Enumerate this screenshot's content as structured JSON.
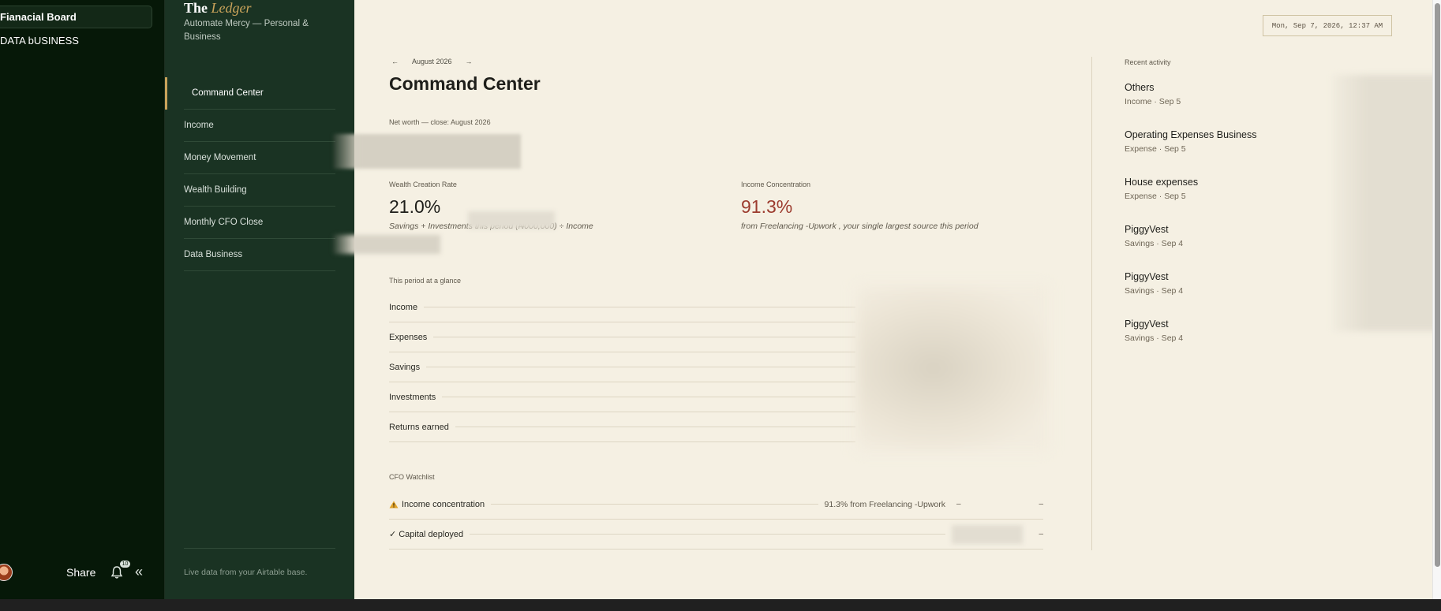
{
  "app_sidebar": {
    "items": [
      {
        "label": "Fianacial Board",
        "active": true
      },
      {
        "label": "DATA bUSINESS",
        "active": false
      }
    ],
    "footer": {
      "share_label": "Share",
      "notification_count": "10"
    }
  },
  "ledger": {
    "brand_prefix": "The",
    "brand_name": "Ledger",
    "subtitle": "Automate Mercy — Personal & Business",
    "nav": [
      {
        "label": "Command Center",
        "active": true
      },
      {
        "label": "Income",
        "active": false
      },
      {
        "label": "Money Movement",
        "active": false
      },
      {
        "label": "Wealth Building",
        "active": false
      },
      {
        "label": "Monthly CFO Close",
        "active": false
      },
      {
        "label": "Data Business",
        "active": false
      }
    ],
    "footer_text": "Live data from your Airtable base."
  },
  "main": {
    "datestamp": "Mon, Sep 7, 2026, 12:37 AM",
    "period": {
      "prev": "←",
      "label": "August 2026",
      "next": "→"
    },
    "title": "Command Center",
    "networth_label": "Net worth — close: August 2026",
    "kpis": [
      {
        "label": "Wealth Creation Rate",
        "value": "21.0%",
        "note": "Savings + Investments this period (₦000,000) ÷ Income"
      },
      {
        "label": "Income Concentration",
        "value": "91.3%",
        "note": "from Freelancing -Upwork , your single largest source this period"
      }
    ],
    "glance": {
      "label": "This period at a glance",
      "rows": [
        "Income",
        "Expenses",
        "Savings",
        "Investments",
        "Returns earned"
      ]
    },
    "watchlist": {
      "label": "CFO Watchlist",
      "rows": [
        {
          "icon": "warning-icon",
          "label": "Income concentration",
          "detail": "91.3% from Freelancing -Upwork",
          "col1": "–",
          "col2": "–"
        },
        {
          "icon": "check-icon",
          "label": "Capital deployed",
          "detail": "",
          "col1": "",
          "col2": "–"
        }
      ]
    }
  },
  "activity": {
    "label": "Recent activity",
    "items": [
      {
        "title": "Others",
        "meta": "Income · Sep 5"
      },
      {
        "title": "Operating Expenses Business",
        "meta": "Expense · Sep 5"
      },
      {
        "title": "House expenses",
        "meta": "Expense · Sep 5"
      },
      {
        "title": "PiggyVest",
        "meta": "Savings · Sep 4"
      },
      {
        "title": "PiggyVest",
        "meta": "Savings · Sep 4"
      },
      {
        "title": "PiggyVest",
        "meta": "Savings · Sep 4"
      }
    ]
  },
  "colors": {
    "accent_gold": "#c9a35a",
    "concentration_red": "#9c3b2e",
    "sidebar_green": "#1a3323",
    "paper": "#f5f0e3"
  }
}
